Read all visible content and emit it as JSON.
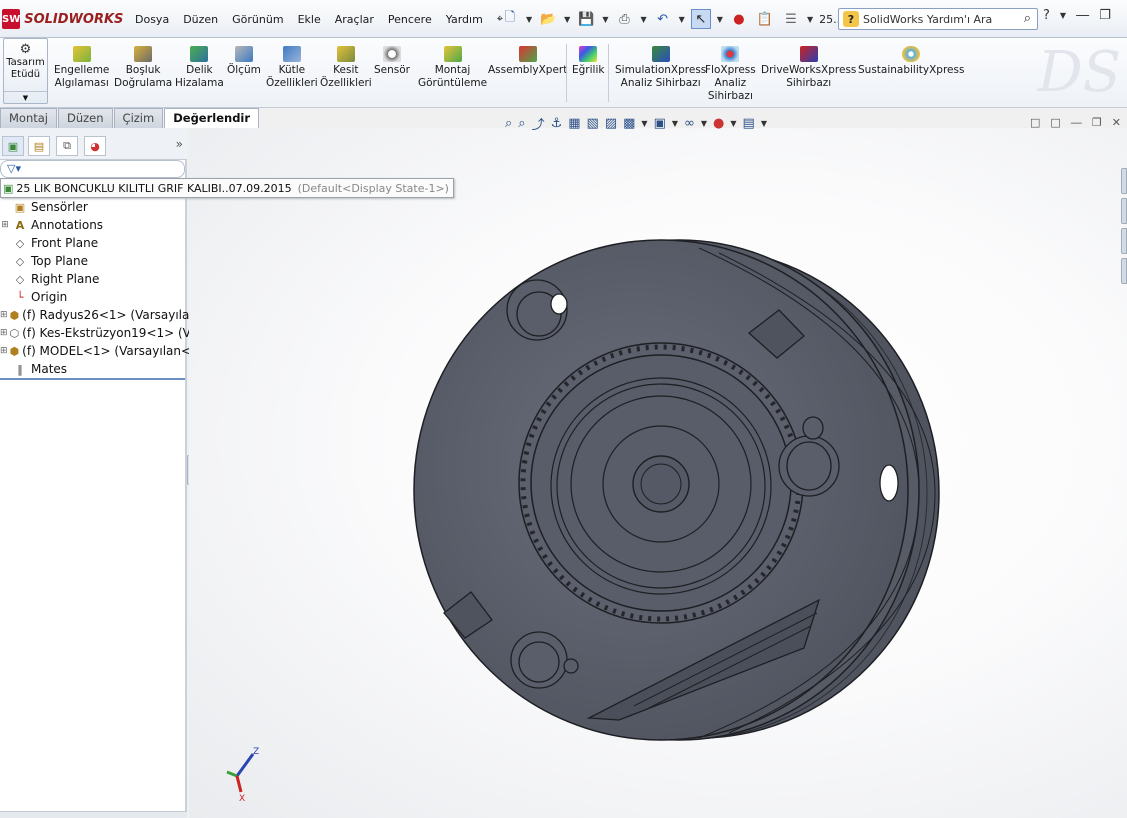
{
  "app": {
    "logo_text": "SOLIDWORKS",
    "logo_mark": "SW",
    "brand_color": "#c8102e"
  },
  "menu": [
    "Dosya",
    "Düzen",
    "Görünüm",
    "Ekle",
    "Araçlar",
    "Pencere",
    "Yardım"
  ],
  "quick_access": {
    "document_name": "25..."
  },
  "help_search": {
    "placeholder": "SolidWorks Yardım'ı Ara",
    "q_badge": "?"
  },
  "command_manager": {
    "design_study": {
      "line1": "Tasarım",
      "line2": "Etüdü"
    },
    "tools": [
      {
        "l1": "Engelleme",
        "l2": "Algılaması",
        "icon": "interference-icon"
      },
      {
        "l1": "Boşluk",
        "l2": "Doğrulama",
        "icon": "clearance-icon"
      },
      {
        "l1": "Delik",
        "l2": "Hizalama",
        "icon": "hole-align-icon"
      },
      {
        "l1": "Ölçüm",
        "l2": "",
        "icon": "measure-icon"
      },
      {
        "l1": "Kütle",
        "l2": "Özellikleri",
        "icon": "mass-props-icon"
      },
      {
        "l1": "Kesit",
        "l2": "Özellikleri",
        "icon": "section-props-icon"
      },
      {
        "l1": "Sensör",
        "l2": "",
        "icon": "sensor-icon"
      },
      {
        "l1": "Montaj",
        "l2": "Görüntüleme",
        "icon": "assembly-vis-icon"
      },
      {
        "l1": "AssemblyXpert",
        "l2": "",
        "icon": "assemblyxpert-icon"
      },
      {
        "l1": "Eğrilik",
        "l2": "",
        "icon": "curvature-icon"
      },
      {
        "l1": "SimulationXpress",
        "l2": "Analiz Sihirbazı",
        "icon": "simxpress-icon"
      },
      {
        "l1": "FloXpress",
        "l2": "Analiz",
        "l3": "Sihirbazı",
        "icon": "floxpress-icon"
      },
      {
        "l1": "DriveWorksXpress",
        "l2": "Sihirbazı",
        "icon": "driveworks-icon"
      },
      {
        "l1": "SustainabilityXpress",
        "l2": "",
        "icon": "sustainability-icon"
      }
    ]
  },
  "tabs": [
    "Montaj",
    "Düzen",
    "Çizim",
    "Değerlendir"
  ],
  "active_tab": "Değerlendir",
  "feature_tree": {
    "root": {
      "name": "25 LIK BONCUKLU KILITLI GRIF KALIBI..07.09.2015",
      "config": "(Default<Display State-1>)"
    },
    "items": [
      {
        "label": "Sensörler",
        "expandable": false
      },
      {
        "label": "Annotations",
        "expandable": true
      },
      {
        "label": "Front Plane",
        "expandable": false
      },
      {
        "label": "Top Plane",
        "expandable": false
      },
      {
        "label": "Right Plane",
        "expandable": false
      },
      {
        "label": "Origin",
        "expandable": false
      },
      {
        "label": "(f) Radyus26<1> (Varsayılan",
        "expandable": true
      },
      {
        "label": "(f) Kes-Ekstrüzyon19<1> (V",
        "expandable": true
      },
      {
        "label": "(f) MODEL<1> (Varsayılan<",
        "expandable": true
      },
      {
        "label": "Mates",
        "expandable": false
      }
    ]
  },
  "triad": {
    "z": "Z",
    "x": "X"
  },
  "colors": {
    "model_fill": "#5d6270",
    "model_edge": "#1e1f24",
    "accent": "#2b5aa8"
  }
}
